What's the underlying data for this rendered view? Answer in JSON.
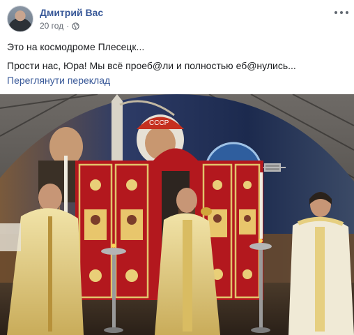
{
  "post": {
    "author": "Дмитрий Вас",
    "timestamp": "20 год",
    "privacy_icon": "globe-icon",
    "more_icon": "more-dots-icon",
    "lines": [
      "Это на космодроме Плесецк...",
      "Прости нас, Юра! Мы всё проеб@ли и полностью еб@нулись..."
    ],
    "translate_link": "Переглянути переклад"
  },
  "photo": {
    "mural_badge": "CCCP"
  },
  "colors": {
    "link": "#385898",
    "meta": "#616770",
    "text": "#1c1e21",
    "vestment_gold": "#e8d38a",
    "iconostasis_red": "#b3181e"
  }
}
